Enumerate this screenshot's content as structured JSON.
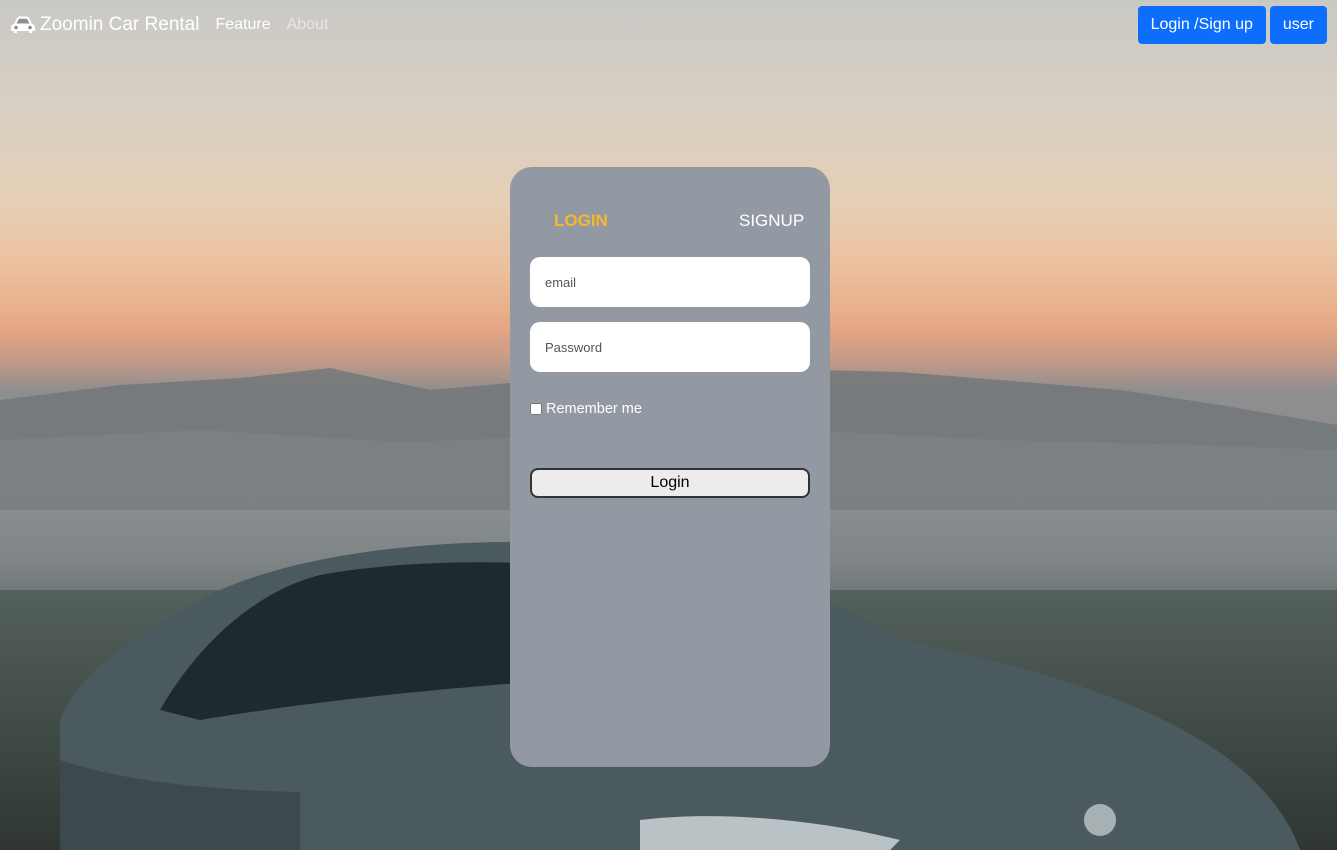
{
  "navbar": {
    "brand": "Zoomin Car Rental",
    "links": [
      {
        "label": "Feature"
      },
      {
        "label": "About"
      }
    ],
    "buttons": {
      "login_signup": "Login /Sign up",
      "user": "user"
    }
  },
  "auth_card": {
    "tabs": {
      "login": "LOGIN",
      "signup": "SIGNUP"
    },
    "email_placeholder": "email",
    "password_placeholder": "Password",
    "remember_label": "Remember me",
    "remember_checked": false,
    "submit_label": "Login"
  },
  "colors": {
    "primary": "#0d6efd",
    "card": "#9399a3",
    "active_tab": "#f5b82e"
  }
}
